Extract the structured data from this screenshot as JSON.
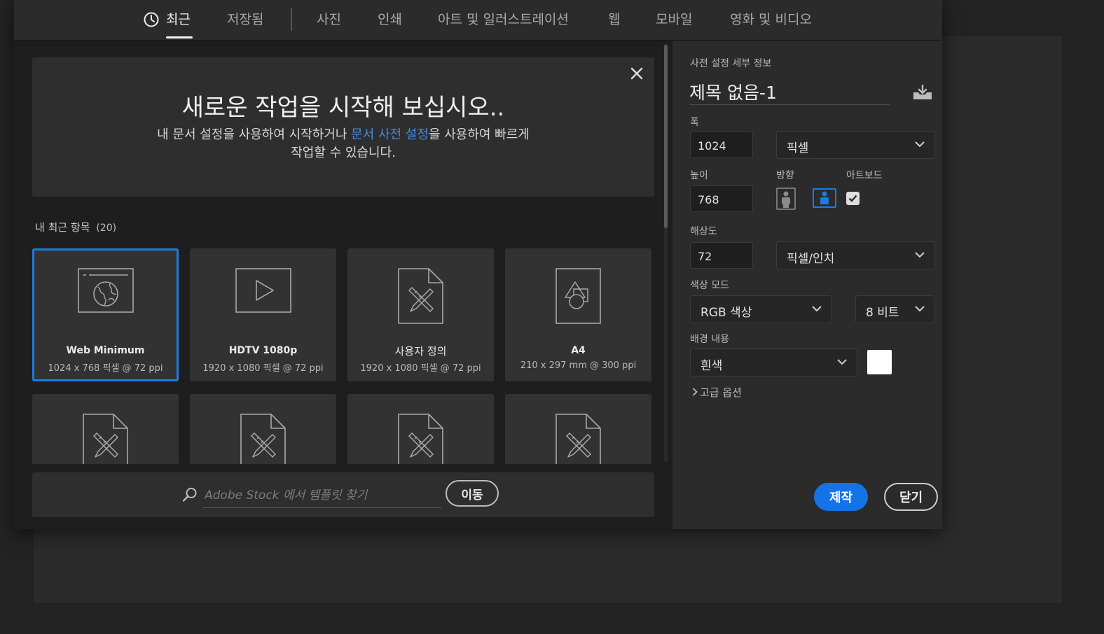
{
  "tabs": {
    "recent": "최근",
    "saved": "저장됨",
    "photo": "사진",
    "print": "인쇄",
    "art": "아트 및 일러스트레이션",
    "web": "웹",
    "mobile": "모바일",
    "film": "영화 및 비디오"
  },
  "welcome": {
    "title": "새로운 작업을 시작해 보십시오..",
    "text_before_link": "내 문서 설정을 사용하여 시작하거나 ",
    "link": "문서 사전 설정",
    "text_after_link": "을 사용하여 빠르게",
    "text_line2": "작업할 수 있습니다."
  },
  "recent": {
    "header": "내 최근 항목",
    "count": "(20)",
    "items": [
      {
        "name": "Web Minimum",
        "dims": "1024 x 768 픽셀 @ 72 ppi",
        "icon": "web-icon"
      },
      {
        "name": "HDTV 1080p",
        "dims": "1920 x 1080 픽셀 @ 72 ppi",
        "icon": "video-icon"
      },
      {
        "name": "사용자 정의",
        "dims": "1920 x 1080 픽셀 @ 72 ppi",
        "icon": "custom-document-icon"
      },
      {
        "name": "A4",
        "dims": "210 x 297 mm @ 300 ppi",
        "icon": "print-document-icon"
      }
    ]
  },
  "stock": {
    "placeholder": "Adobe Stock 에서 템플릿 찾기",
    "go": "이동"
  },
  "details": {
    "section_title": "사전 설정 세부 정보",
    "doc_name": "제목 없음-1",
    "width_label": "폭",
    "width": "1024",
    "width_unit": "픽셀",
    "height_label": "높이",
    "height": "768",
    "orientation_label": "방향",
    "artboard_label": "아트보드",
    "artboard_checked": true,
    "resolution_label": "해상도",
    "resolution": "72",
    "resolution_unit": "픽셀/인치",
    "color_mode_label": "색상 모드",
    "color_mode": "RGB 색상",
    "bit_depth": "8 비트",
    "background_label": "배경 내용",
    "background": "흰색",
    "background_color": "#ffffff",
    "advanced": "고급 옵션",
    "create": "제작",
    "close": "닫기"
  },
  "colors": {
    "accent": "#1473e6",
    "link": "#3d8ee6",
    "selected_border": "#1e7ae3"
  }
}
